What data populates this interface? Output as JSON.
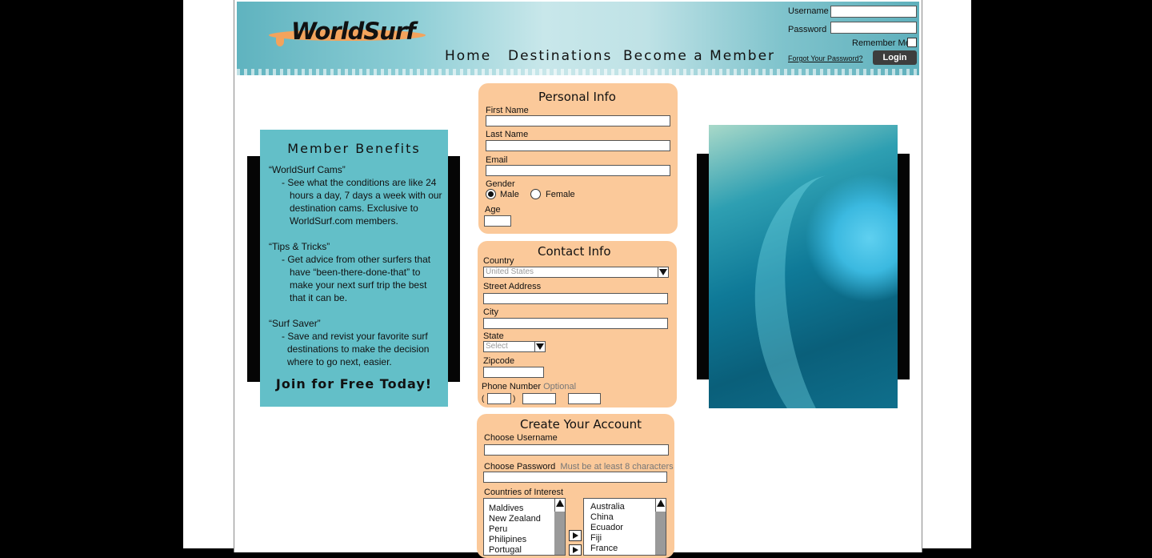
{
  "header": {
    "logo_text": "WorldSurf",
    "nav": [
      "Home",
      "Destinations",
      "Become a Member"
    ],
    "login": {
      "username_label": "Username",
      "password_label": "Password",
      "remember_label": "Remember Me",
      "forgot_link": "Forgot Your Password?",
      "login_button": "Login"
    }
  },
  "benefits": {
    "title": "Member Benefits",
    "lines": [
      "“WorldSurf Cams”",
      "- See what the conditions are like 24",
      "hours a day, 7 days a week with our",
      "destination cams.  Exclusive to",
      "WorldSurf.com members.",
      "“Tips & Tricks”",
      "- Get advice from other surfers that",
      "have “been-there-done-that” to",
      "make your next surf trip the best",
      "that it can be.",
      "“Surf Saver”",
      "- Save and revist your favorite surf",
      "destinations to make the decision",
      "where to go next, easier."
    ],
    "cta": "Join for Free Today!"
  },
  "personal": {
    "title": "Personal Info",
    "first_name": "First Name",
    "last_name": "Last Name",
    "email": "Email",
    "gender": "Gender",
    "male": "Male",
    "female": "Female",
    "gender_selected": "Male",
    "age": "Age"
  },
  "contact": {
    "title": "Contact Info",
    "country": "Country",
    "country_value": "United States",
    "street": "Street Address",
    "city": "City",
    "state": "State",
    "state_value": "Select",
    "zipcode": "Zipcode",
    "phone": "Phone Number",
    "phone_hint": "Optional",
    "paren_open": "(",
    "paren_close": ")"
  },
  "account": {
    "title": "Create Your Account",
    "username": "Choose Username",
    "password": "Choose Password",
    "password_hint": "Must be at least 8 characters",
    "countries_label": "Countries of Interest",
    "available": [
      "Maldives",
      "New Zealand",
      "Peru",
      "Philipines",
      "Portugal"
    ],
    "selected": [
      "Australia",
      "China",
      "Ecuador",
      "Fiji",
      "France"
    ]
  },
  "icons": {
    "dropdown": "triangle-down",
    "scroll_up": "triangle-up",
    "move": "triangle-right"
  }
}
